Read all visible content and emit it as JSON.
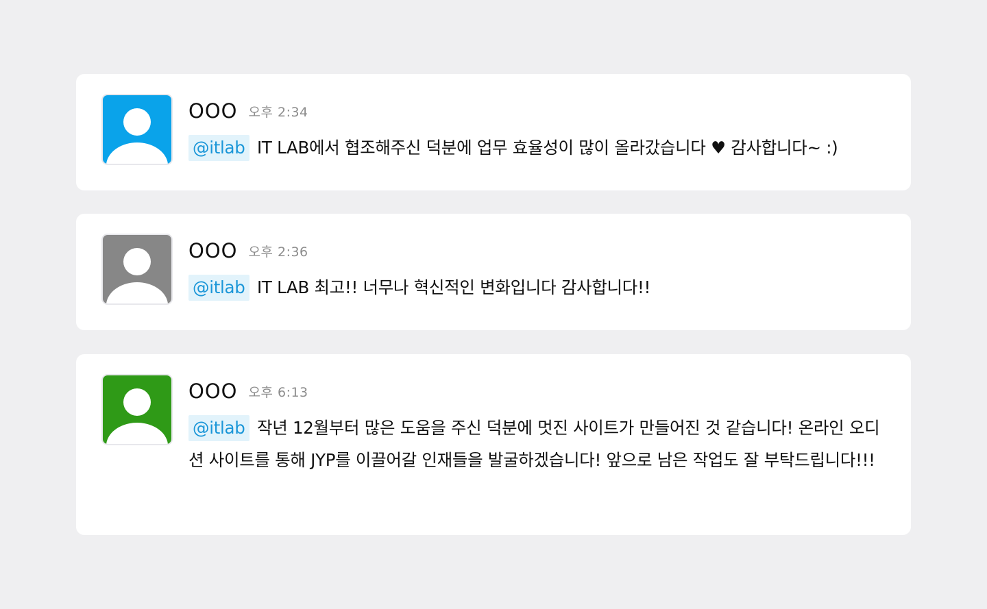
{
  "comments": [
    {
      "avatar_color": "#0aa3ea",
      "avatar_icon": "user-silhouette-icon",
      "author": "OOO",
      "time": "오후 2:34",
      "mention": "@itlab",
      "text": "IT LAB에서 협조해주신 덕분에 업무 효율성이 많이 올라갔습니다 ♥ 감사합니다~ :)"
    },
    {
      "avatar_color": "#878787",
      "avatar_icon": "user-silhouette-icon",
      "author": "OOO",
      "time": "오후 2:36",
      "mention": "@itlab",
      "text": "IT LAB 최고!! 너무나 혁신적인 변화입니다 감사합니다!!"
    },
    {
      "avatar_color": "#2f9a17",
      "avatar_icon": "user-silhouette-icon",
      "author": "OOO",
      "time": "오후 6:13",
      "mention": "@itlab",
      "text": "작년 12월부터 많은 도움을 주신 덕분에 멋진 사이트가 만들어진 것 같습니다! 온라인 오디션 사이트를 통해 JYP를 이끌어갈 인재들을 발굴하겠습니다! 앞으로 남은 작업도 잘 부탁드립니다!!!"
    }
  ]
}
